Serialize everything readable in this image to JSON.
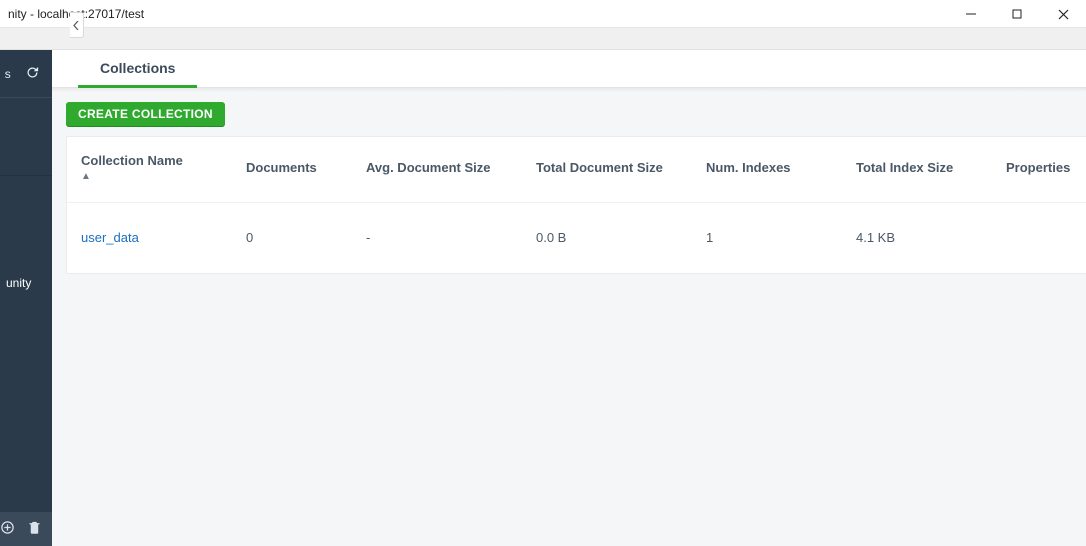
{
  "window": {
    "title": "nity - localhost:27017/test"
  },
  "sidebar": {
    "top_label": "s",
    "middle_label": "unity"
  },
  "tabs": {
    "collections": "Collections"
  },
  "toolbar": {
    "create_label": "CREATE COLLECTION"
  },
  "table": {
    "headers": {
      "name": "Collection Name",
      "documents": "Documents",
      "avg_size": "Avg. Document Size",
      "total_size": "Total Document Size",
      "num_indexes": "Num. Indexes",
      "total_index": "Total Index Size",
      "properties": "Properties"
    },
    "rows": [
      {
        "name": "user_data",
        "documents": "0",
        "avg_size": "-",
        "total_size": "0.0 B",
        "num_indexes": "1",
        "total_index": "4.1 KB",
        "properties": ""
      }
    ]
  }
}
